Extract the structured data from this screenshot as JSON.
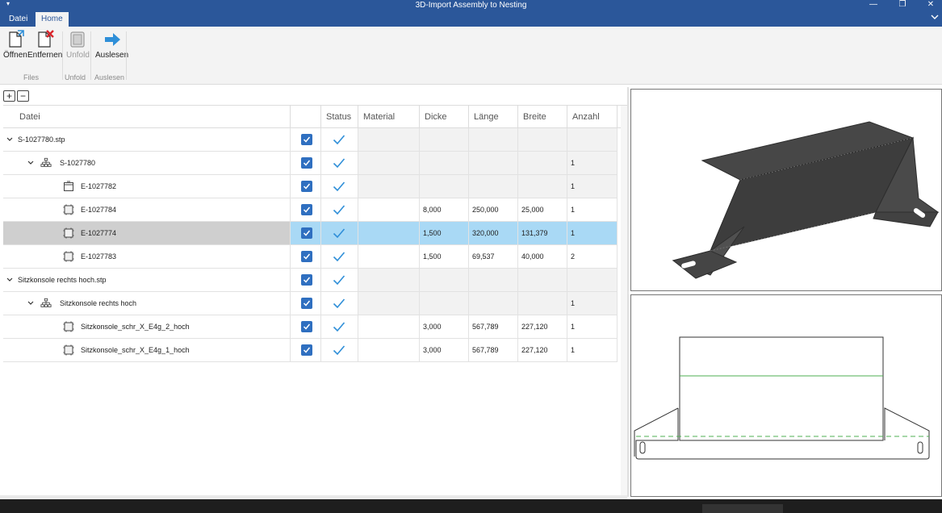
{
  "window": {
    "title": "3D-Import Assembly to Nesting",
    "controls": {
      "minimize": "—",
      "maximize": "❐",
      "close": "✕"
    },
    "quick_access": "▾"
  },
  "tabs": [
    {
      "label": "Datei",
      "active": false
    },
    {
      "label": "Home",
      "active": true
    }
  ],
  "ribbon": {
    "buttons": {
      "open": "Öffnen",
      "remove": "Entfernen",
      "unfold": "Unfold",
      "read": "Auslesen"
    },
    "groups": {
      "files": "Files",
      "unfold": "Unfold",
      "read": "Auslesen"
    }
  },
  "tree_tools": {
    "expand": "+",
    "collapse": "−"
  },
  "columns": {
    "file": "Datei",
    "check": "",
    "status": "Status",
    "material": "Material",
    "thickness": "Dicke",
    "length": "Länge",
    "width": "Breite",
    "count": "Anzahl"
  },
  "rows": [
    {
      "name": "S-1027780.stp",
      "level": 0,
      "expander": "⌄",
      "icon": "",
      "checked": true,
      "status": "ok",
      "material": "",
      "thickness": "",
      "length": "",
      "width": "",
      "count": "",
      "grey": true
    },
    {
      "name": "S-1027780",
      "level": 1,
      "expander": "⌄",
      "icon": "assembly-icon",
      "checked": true,
      "status": "ok",
      "material": "",
      "thickness": "",
      "length": "",
      "width": "",
      "count": "1",
      "grey": true
    },
    {
      "name": "E-1027782",
      "level": 2,
      "expander": "",
      "icon": "part-box-icon",
      "checked": true,
      "status": "ok",
      "material": "",
      "thickness": "",
      "length": "",
      "width": "",
      "count": "1",
      "grey": true
    },
    {
      "name": "E-1027784",
      "level": 2,
      "expander": "",
      "icon": "sheet-part-icon",
      "checked": true,
      "status": "ok",
      "material": "",
      "thickness": "8,000",
      "length": "250,000",
      "width": "25,000",
      "count": "1",
      "grey": false
    },
    {
      "name": "E-1027774",
      "level": 2,
      "expander": "",
      "icon": "sheet-part-icon",
      "checked": true,
      "status": "ok",
      "material": "",
      "thickness": "1,500",
      "length": "320,000",
      "width": "131,379",
      "count": "1",
      "grey": false,
      "selected": true
    },
    {
      "name": "E-1027783",
      "level": 2,
      "expander": "",
      "icon": "sheet-part-icon",
      "checked": true,
      "status": "ok",
      "material": "",
      "thickness": "1,500",
      "length": "69,537",
      "width": "40,000",
      "count": "2",
      "grey": false
    },
    {
      "name": "Sitzkonsole rechts hoch.stp",
      "level": 0,
      "expander": "⌄",
      "icon": "",
      "checked": true,
      "status": "ok",
      "material": "",
      "thickness": "",
      "length": "",
      "width": "",
      "count": "",
      "grey": true
    },
    {
      "name": "Sitzkonsole rechts hoch",
      "level": 1,
      "expander": "⌄",
      "icon": "assembly-icon",
      "checked": true,
      "status": "ok",
      "material": "",
      "thickness": "",
      "length": "",
      "width": "",
      "count": "1",
      "grey": true
    },
    {
      "name": "Sitzkonsole_schr_X_E4g_2_hoch",
      "level": 2,
      "expander": "",
      "icon": "sheet-part-icon",
      "checked": true,
      "status": "ok",
      "material": "",
      "thickness": "3,000",
      "length": "567,789",
      "width": "227,120",
      "count": "1",
      "grey": false
    },
    {
      "name": "Sitzkonsole_schr_X_E4g_1_hoch",
      "level": 2,
      "expander": "",
      "icon": "sheet-part-icon",
      "checked": true,
      "status": "ok",
      "material": "",
      "thickness": "3,000",
      "length": "567,789",
      "width": "227,120",
      "count": "1",
      "grey": false
    }
  ],
  "colors": {
    "title_bar": "#2b579a",
    "selection": "#a9d9f5",
    "checkbox": "#2f6fc0",
    "status_tick": "#2f8fd8",
    "bend_line": "#4caf50",
    "part_dark": "#4a4a4a"
  }
}
